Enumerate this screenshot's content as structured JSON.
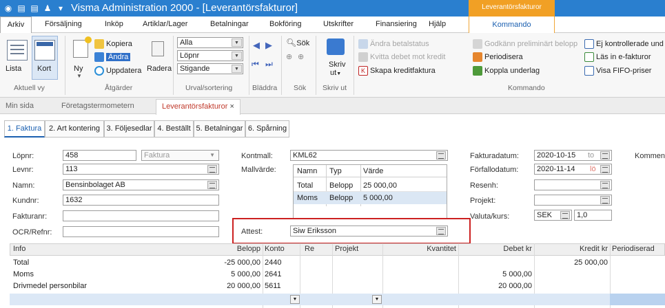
{
  "window": {
    "title": "Visma Administration 2000 - [Leverantörsfakturor]",
    "context_tab": "Leverantörsfakturor"
  },
  "quick_access": [
    "app-icon",
    "note-icon",
    "note-icon",
    "user-icon",
    "dropdown-icon"
  ],
  "menu": [
    "Arkiv",
    "Försäljning",
    "Inköp",
    "Artiklar/Lager",
    "Betalningar",
    "Bokföring",
    "Utskrifter",
    "Finansiering",
    "Hjälp",
    "Kommando"
  ],
  "ribbon": {
    "view": {
      "list": "Lista",
      "card": "Kort",
      "label": "Aktuell vy"
    },
    "actions": {
      "new": "Ny",
      "copy": "Kopiera",
      "change": "Ändra",
      "update": "Uppdatera",
      "delete": "Radera",
      "label": "Åtgärder"
    },
    "sort": {
      "filter": "Alla",
      "field": "Löpnr",
      "order": "Stigande",
      "label": "Urval/sortering"
    },
    "browse": {
      "label": "Bläddra"
    },
    "search": {
      "search": "Sök",
      "label": "Sök"
    },
    "print": {
      "print": "Skriv",
      "out": "ut",
      "label": "Skriv ut"
    },
    "commands": {
      "change_payment": "Ändra betalstatus",
      "settle": "Kvitta debet mot kredit",
      "credit": "Skapa kreditfaktura",
      "approve": "Godkänn preliminärt belopp",
      "periodize": "Periodisera",
      "link": "Koppla underlag",
      "unchecked": "Ej kontrollerade und",
      "einvoice": "Läs in e-fakturor",
      "fifo": "Visa FIFO-priser",
      "label": "Kommando"
    }
  },
  "doc_tabs": [
    "Min sida",
    "Företagstermometern",
    "Leverantörsfakturor",
    "×"
  ],
  "sub_tabs": [
    "1. Faktura",
    "2. Art kontering",
    "3. Följesedlar",
    "4. Beställt",
    "5. Betalningar",
    "6. Spårning"
  ],
  "form": {
    "lopnr_label": "Löpnr:",
    "lopnr": "458",
    "type": "Faktura",
    "levnr_label": "Levnr:",
    "levnr": "113",
    "namn_label": "Namn:",
    "namn": "Bensinbolaget AB",
    "kundnr_label": "Kundnr:",
    "kundnr": "1632",
    "fakturanr_label": "Fakturanr:",
    "fakturanr": "",
    "ocr_label": "OCR/Refnr:",
    "ocr": "",
    "kontmall_label": "Kontmall:",
    "kontmall": "KML62",
    "mallvarde_label": "Mallvärde:",
    "attest_label": "Attest:",
    "attest": "Siw Eriksson",
    "fakturadatum_label": "Fakturadatum:",
    "fakturadatum": "2020-10-15",
    "fakturadatum_day": "to",
    "forfallodatum_label": "Förfallodatum:",
    "forfallodatum": "2020-11-14",
    "forfallodatum_day": "lö",
    "resenh_label": "Resenh:",
    "projekt_label": "Projekt:",
    "valuta_label": "Valuta/kurs:",
    "valuta": "SEK",
    "kurs": "1,0",
    "comment_label": "Komment"
  },
  "template_table": {
    "headers": [
      "Namn",
      "Typ",
      "Värde"
    ],
    "rows": [
      [
        "Total",
        "Belopp",
        "25 000,00"
      ],
      [
        "Moms",
        "Belopp",
        "5 000,00"
      ]
    ]
  },
  "grid": {
    "headers": [
      "Info",
      "Belopp",
      "Konto",
      "Re",
      "Projekt",
      "Kvantitet",
      "Debet kr",
      "Kredit kr",
      "Periodiserad"
    ],
    "rows": [
      {
        "info": "Total",
        "belopp": "-25 000,00",
        "konto": "2440",
        "debet": "",
        "kredit": "25 000,00"
      },
      {
        "info": "Moms",
        "belopp": "5 000,00",
        "konto": "2641",
        "debet": "5 000,00",
        "kredit": ""
      },
      {
        "info": "Drivmedel personbilar",
        "belopp": "20 000,00",
        "konto": "5611",
        "debet": "20 000,00",
        "kredit": ""
      }
    ]
  }
}
